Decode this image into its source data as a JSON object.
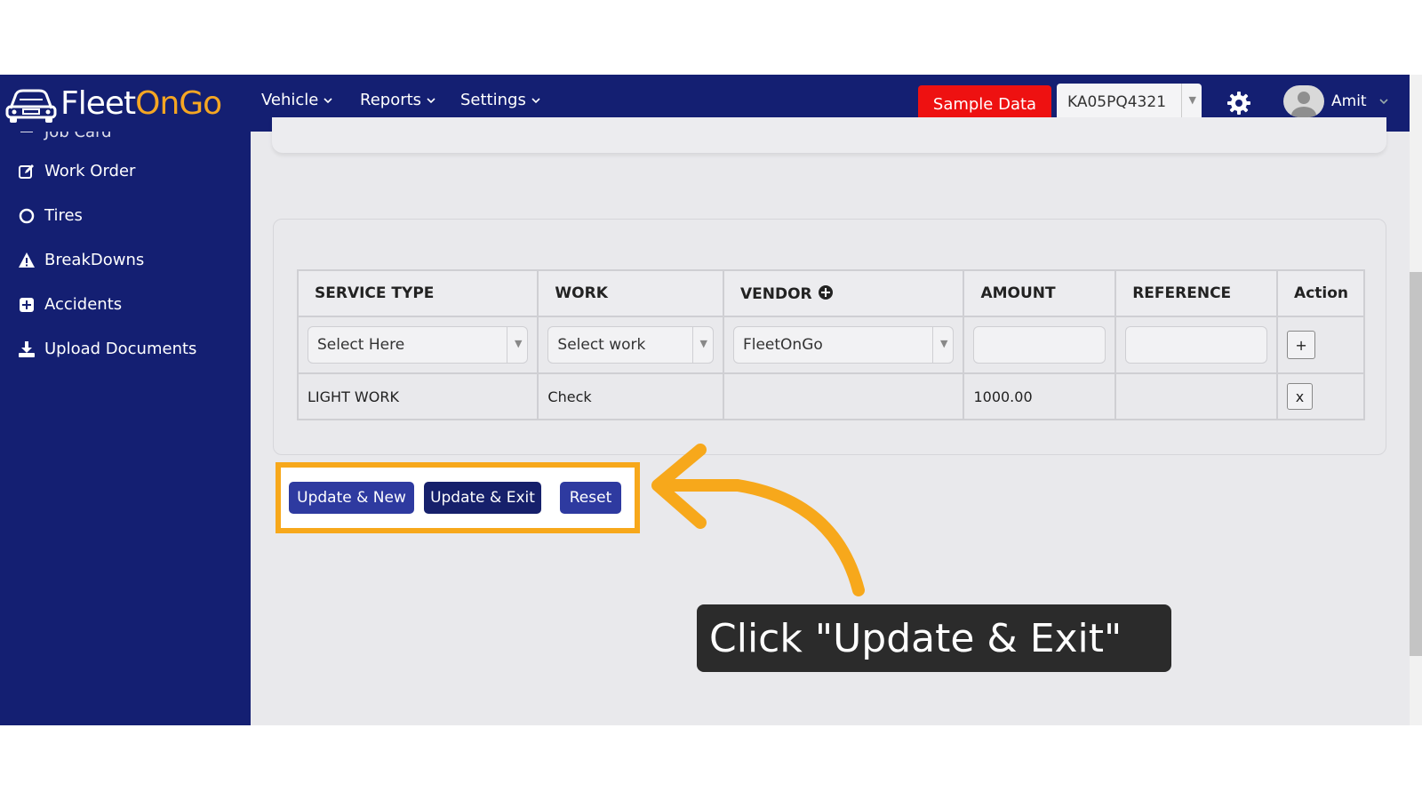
{
  "app": {
    "brand_prefix": "Fleet",
    "brand_accent": "OnGo",
    "brand_accent_color": "#f5a623",
    "nav_color": "#141f72"
  },
  "nav": {
    "items": [
      {
        "label": "Vehicle"
      },
      {
        "label": "Reports"
      },
      {
        "label": "Settings"
      }
    ],
    "sample_data_label": "Sample Data",
    "vehicle_selected": "KA05PQ4321",
    "user_name": "Amit"
  },
  "sidebar": {
    "partial_item": "Job Card",
    "items": [
      {
        "label": "Work Order",
        "icon": "edit-icon"
      },
      {
        "label": "Tires",
        "icon": "circle-icon"
      },
      {
        "label": "BreakDowns",
        "icon": "warning-icon"
      },
      {
        "label": "Accidents",
        "icon": "plus-square-icon"
      },
      {
        "label": "Upload Documents",
        "icon": "download-icon"
      }
    ]
  },
  "table": {
    "headers": [
      "SERVICE TYPE",
      "WORK",
      "VENDOR",
      "AMOUNT",
      "REFERENCE",
      "Action"
    ],
    "input_row": {
      "service_type": "Select Here",
      "work": "Select work",
      "vendor": "FleetOnGo",
      "amount": "",
      "reference": "",
      "add_label": "+"
    },
    "rows": [
      {
        "service_type": "LIGHT WORK",
        "work": "Check",
        "vendor": "",
        "amount": "1000.00",
        "reference": "",
        "remove_label": "x"
      }
    ]
  },
  "actions": {
    "update_new": "Update & New",
    "update_exit": "Update & Exit",
    "reset": "Reset"
  },
  "callout": {
    "text": "Click \"Update & Exit\"",
    "highlight_color": "#f7a81b"
  }
}
